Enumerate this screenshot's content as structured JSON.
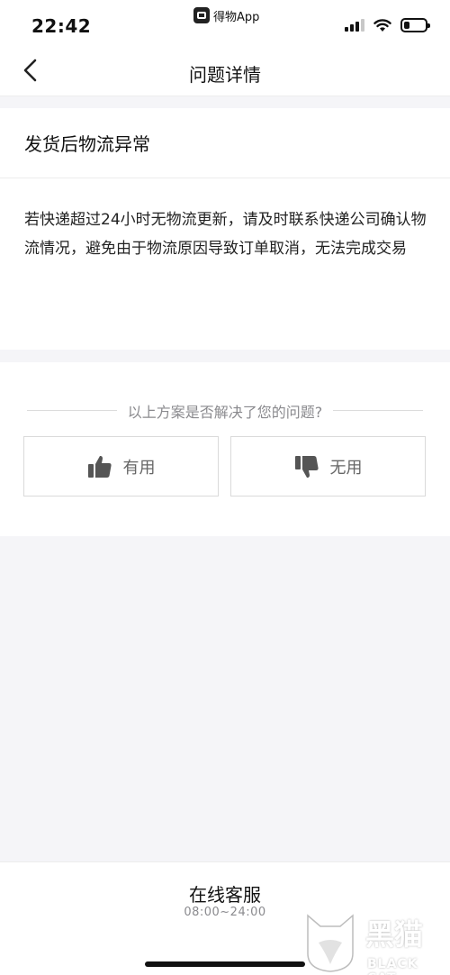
{
  "status_bar": {
    "time": "22:42",
    "app_name": "得物App"
  },
  "nav": {
    "title": "问题详情"
  },
  "question": {
    "title": "发货后物流异常",
    "body": "若快递超过24小时无物流更新，请及时联系快递公司确认物流情况，避免由于物流原因导致订单取消，无法完成交易"
  },
  "feedback": {
    "prompt": "以上方案是否解决了您的问题?",
    "useful_label": "有用",
    "useless_label": "无用"
  },
  "customer_service": {
    "title": "在线客服",
    "hours": "08:00~24:00"
  },
  "watermark": {
    "cn": "黑猫",
    "en": "BLACK CAT"
  }
}
